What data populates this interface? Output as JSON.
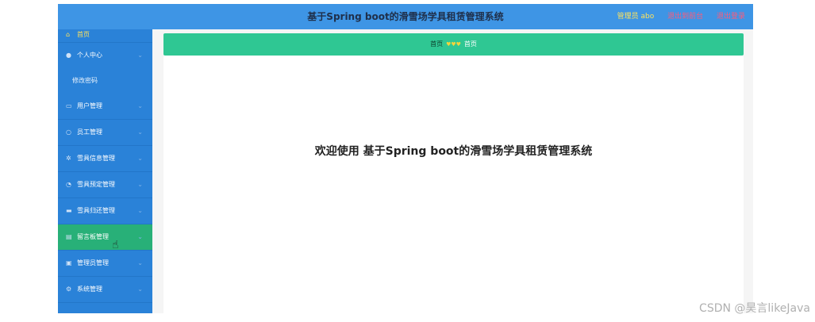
{
  "header": {
    "title": "基于Spring boot的滑雪场学具租赁管理系统",
    "admin_label": "管理员 abo",
    "back_link": "退出到前台",
    "logout_link": "退出登录"
  },
  "sidebar": {
    "items": [
      {
        "label": "首页",
        "icon": "home-icon"
      },
      {
        "label": "个人中心",
        "icon": "user-icon"
      },
      {
        "label": "修改密码",
        "icon": ""
      },
      {
        "label": "用户管理",
        "icon": "list-icon"
      },
      {
        "label": "员工管理",
        "icon": "staff-icon"
      },
      {
        "label": "雪具信息管理",
        "icon": "gear-icon"
      },
      {
        "label": "雪具预定管理",
        "icon": "clock-icon"
      },
      {
        "label": "雪具归还管理",
        "icon": "box-icon"
      },
      {
        "label": "留言板管理",
        "icon": "message-icon"
      },
      {
        "label": "管理员管理",
        "icon": "admin-icon"
      },
      {
        "label": "系统管理",
        "icon": "settings-icon"
      }
    ]
  },
  "breadcrumb": {
    "root": "首页",
    "current": "首页"
  },
  "main": {
    "welcome": "欢迎使用 基于Spring boot的滑雪场学具租赁管理系统"
  },
  "watermark": "CSDN @昊言likeJava",
  "colors": {
    "header": "#3e95e5",
    "sidebar": "#2a82d8",
    "accent": "#2fc793",
    "active": "#28b078"
  }
}
